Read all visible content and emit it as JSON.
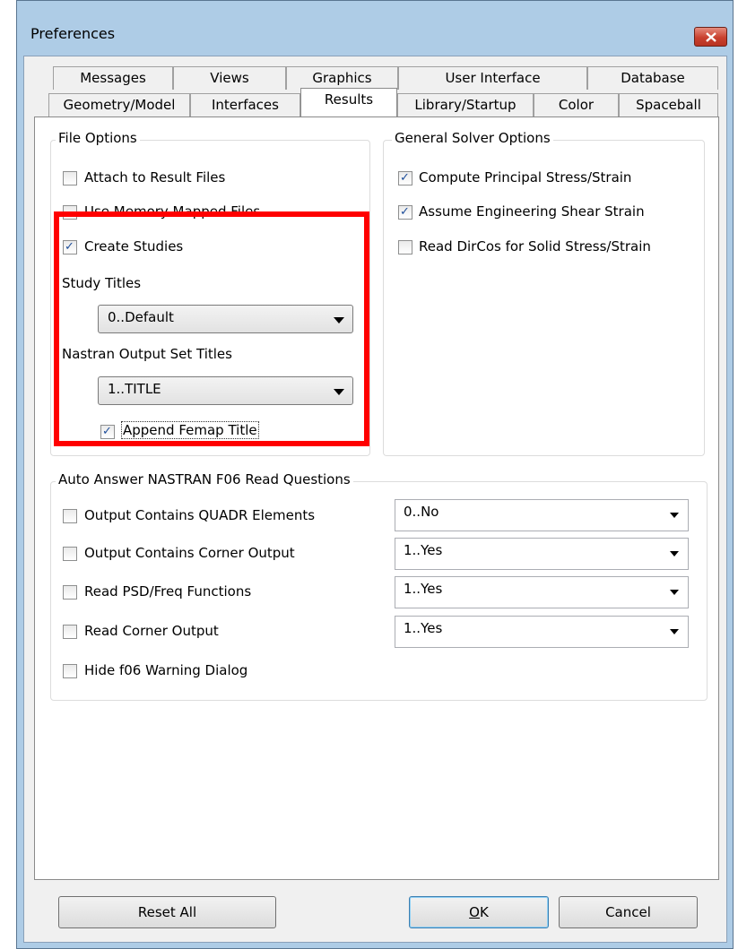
{
  "window": {
    "title": "Preferences"
  },
  "tabs_row1": [
    "Messages",
    "Views",
    "Graphics",
    "User Interface",
    "Database"
  ],
  "tabs_row2": [
    "Geometry/Model",
    "Interfaces",
    "Results",
    "Library/Startup",
    "Color",
    "Spaceball"
  ],
  "active_tab": "Results",
  "file_options": {
    "title": "File Options",
    "attach": {
      "label": "Attach to Result Files",
      "checked": false
    },
    "memory_mapped": {
      "label": "Use Memory Mapped Files",
      "checked": false
    },
    "create_studies": {
      "label": "Create Studies",
      "checked": true
    },
    "study_titles_label": "Study Titles",
    "study_titles_value": "0..Default",
    "nastran_titles_label": "Nastran Output Set Titles",
    "nastran_titles_value": "1..TITLE",
    "append_femap": {
      "label": "Append Femap Title",
      "checked": true
    }
  },
  "solver_options": {
    "title": "General Solver Options",
    "principal": {
      "label": "Compute Principal Stress/Strain",
      "checked": true
    },
    "shear": {
      "label": "Assume Engineering Shear Strain",
      "checked": true
    },
    "dircos": {
      "label": "Read DirCos for Solid Stress/Strain",
      "checked": false
    }
  },
  "auto_answer": {
    "title": "Auto Answer NASTRAN F06 Read Questions",
    "rows": [
      {
        "label": "Output Contains QUADR Elements",
        "value": "0..No",
        "checked": false
      },
      {
        "label": "Output Contains Corner Output",
        "value": "1..Yes",
        "checked": false
      },
      {
        "label": "Read PSD/Freq Functions",
        "value": "1..Yes",
        "checked": false
      },
      {
        "label": "Read Corner Output",
        "value": "1..Yes",
        "checked": false
      }
    ],
    "hide_warning": {
      "label": "Hide f06 Warning Dialog",
      "checked": false
    }
  },
  "buttons": {
    "reset": "Reset All",
    "ok": "OK",
    "cancel": "Cancel"
  },
  "colors": {
    "highlight": "#ff0000",
    "close_button": "#c9412f",
    "check_mark": "#1e4e9a"
  }
}
